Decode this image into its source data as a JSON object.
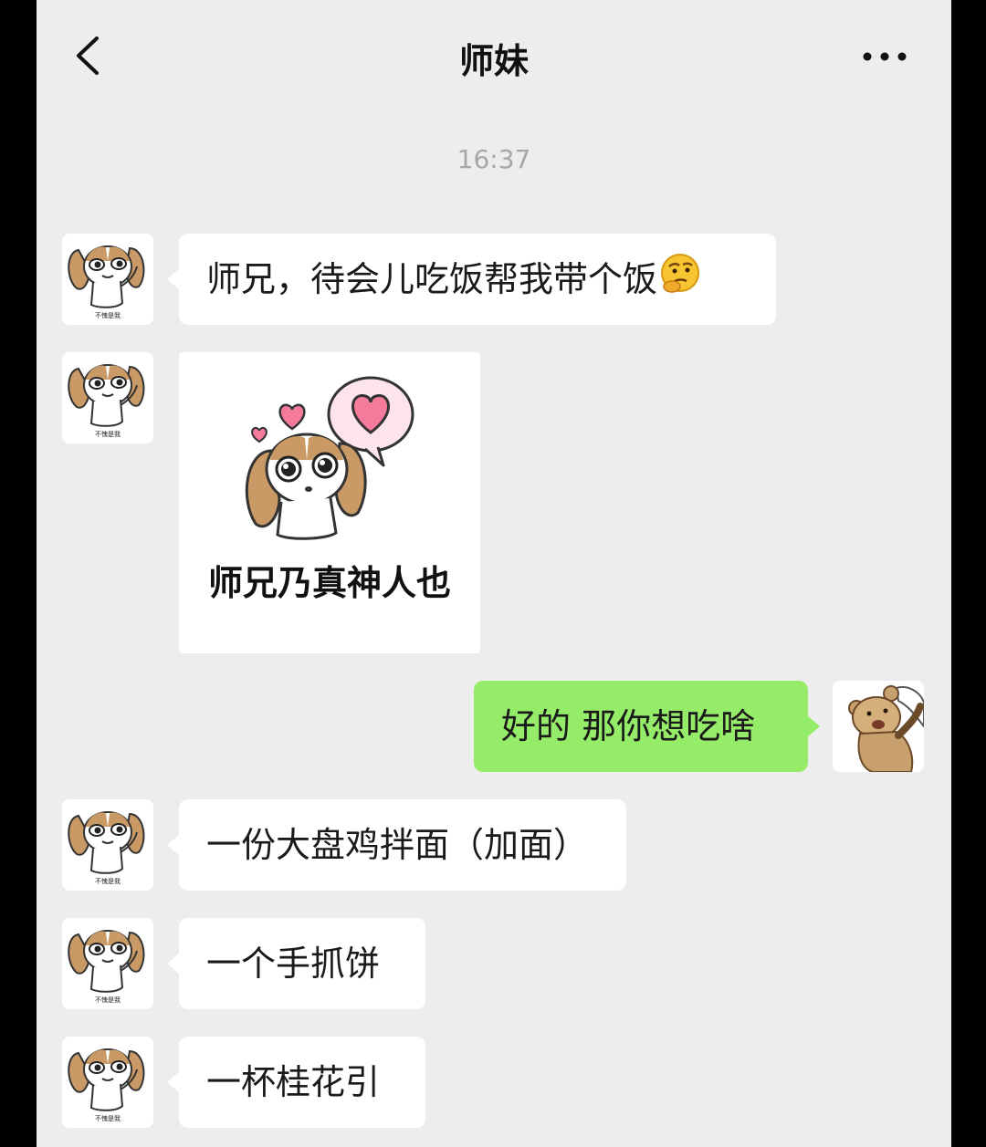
{
  "header": {
    "title": "师妹",
    "back_icon": "chevron-left-icon",
    "more_icon": "more-dots-icon"
  },
  "timestamp": "16:37",
  "avatar_caption": "不愧是我",
  "messages": [
    {
      "from": "contact",
      "type": "text",
      "text": "师兄，待会儿吃饭帮我带个饭",
      "emoji": "thinking-face-emoji"
    },
    {
      "from": "contact",
      "type": "sticker",
      "caption": "师兄乃真神人也"
    },
    {
      "from": "me",
      "type": "text",
      "text": "好的 那你想吃啥"
    },
    {
      "from": "contact",
      "type": "text",
      "text": "一份大盘鸡拌面（加面）"
    },
    {
      "from": "contact",
      "type": "text",
      "text": "一个手抓饼"
    },
    {
      "from": "contact",
      "type": "text",
      "text": "一杯桂花引"
    }
  ],
  "colors": {
    "background": "#ededed",
    "incoming_bubble": "#ffffff",
    "outgoing_bubble": "#95ec69",
    "timestamp": "#a7a7a7"
  }
}
